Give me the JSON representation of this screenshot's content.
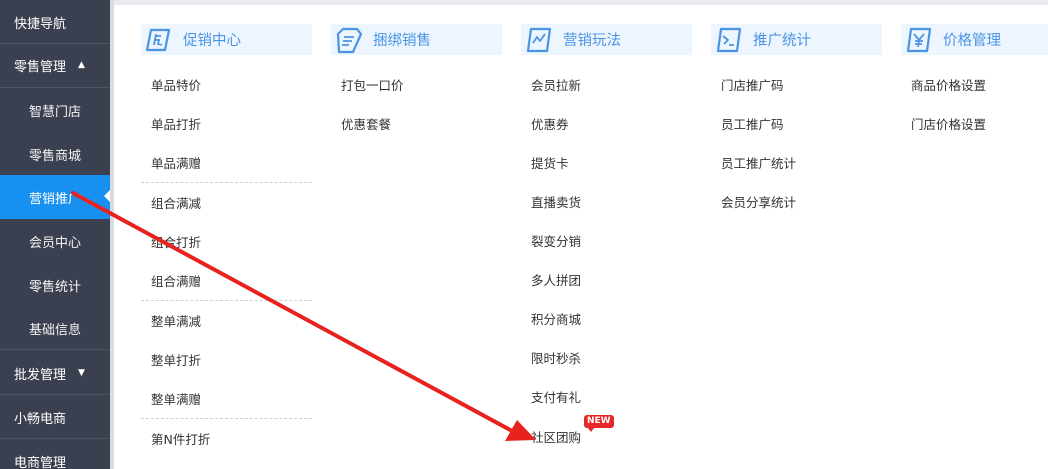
{
  "sidebar": {
    "items": [
      {
        "label": "快捷导航"
      },
      {
        "label": "零售管理"
      },
      {
        "label": "智慧门店"
      },
      {
        "label": "零售商城"
      },
      {
        "label": "营销推广"
      },
      {
        "label": "会员中心"
      },
      {
        "label": "零售统计"
      },
      {
        "label": "基础信息"
      },
      {
        "label": "批发管理"
      },
      {
        "label": "小畅电商"
      },
      {
        "label": "电商管理"
      }
    ],
    "caret_up": "▲",
    "caret_down": "▼"
  },
  "columns": [
    {
      "title": "促销中心",
      "icon": "promo-icon",
      "items": [
        "单品特价",
        "单品打折",
        "单品满赠",
        "组合满减",
        "组合打折",
        "组合满赠",
        "整单满减",
        "整单打折",
        "整单满赠",
        "第N件打折"
      ]
    },
    {
      "title": "捆绑销售",
      "icon": "bundle-icon",
      "items": [
        "打包一口价",
        "优惠套餐"
      ]
    },
    {
      "title": "营销玩法",
      "icon": "marketing-icon",
      "items": [
        "会员拉新",
        "优惠券",
        "提货卡",
        "直播卖货",
        "裂变分销",
        "多人拼团",
        "积分商城",
        "限时秒杀",
        "支付有礼",
        "社区团购"
      ],
      "badge": "NEW"
    },
    {
      "title": "推广统计",
      "icon": "stats-icon",
      "items": [
        "门店推广码",
        "员工推广码",
        "员工推广统计",
        "会员分享统计"
      ]
    },
    {
      "title": "价格管理",
      "icon": "price-icon",
      "items": [
        "商品价格设置",
        "门店价格设置"
      ]
    }
  ],
  "colors": {
    "sidebar_bg": "#3b4050",
    "active": "#1890f0",
    "header_bg": "#edf5ff",
    "header_text": "#4a95e3",
    "arrow": "#e8231f",
    "badge": "#e8272b"
  }
}
